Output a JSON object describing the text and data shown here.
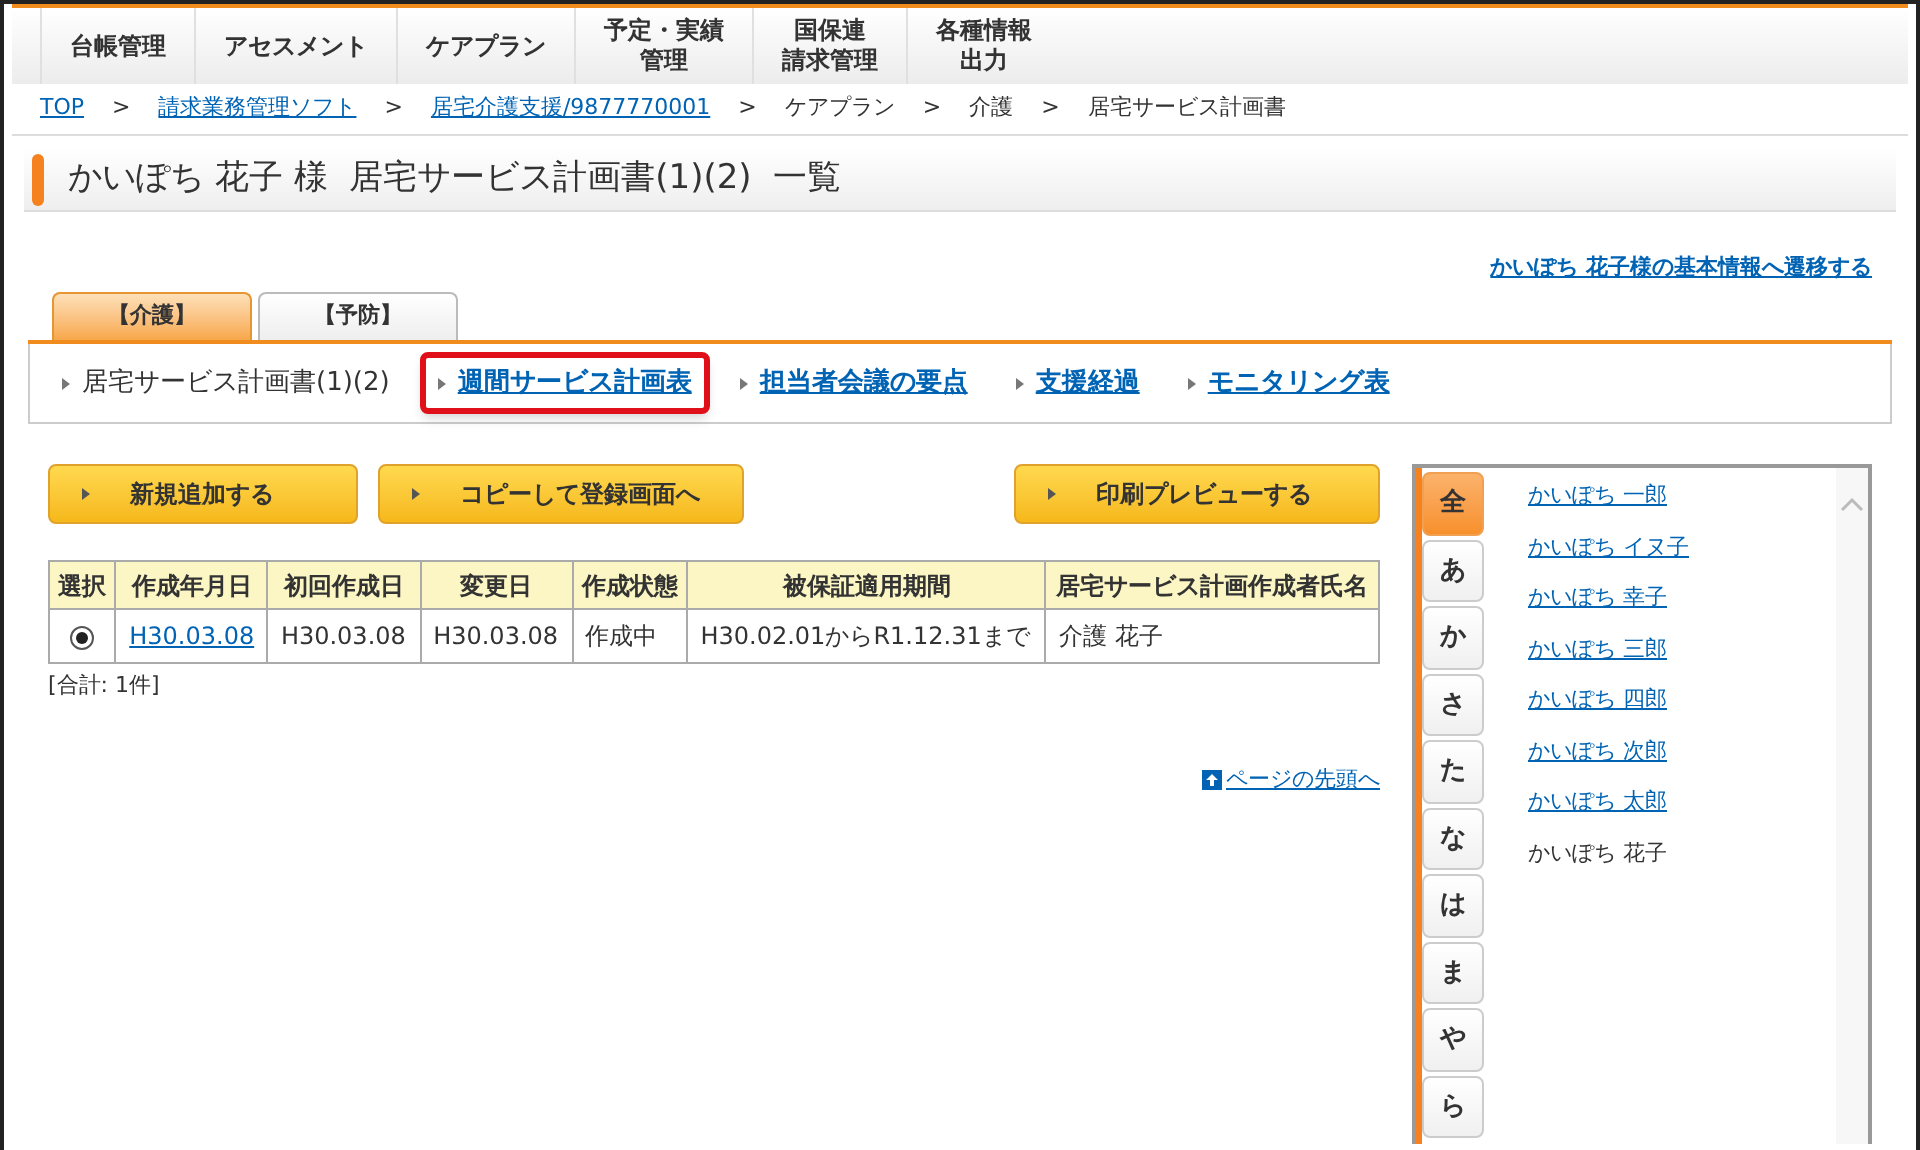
{
  "menu": [
    {
      "lines": [
        "台帳管理"
      ]
    },
    {
      "lines": [
        "アセスメント"
      ]
    },
    {
      "lines": [
        "ケアプラン"
      ]
    },
    {
      "lines": [
        "予定・実績",
        "管理"
      ]
    },
    {
      "lines": [
        "国保連",
        "請求管理"
      ]
    },
    {
      "lines": [
        "各種情報",
        "出力"
      ]
    }
  ],
  "breadcrumb": [
    {
      "label": "TOP",
      "link": true
    },
    {
      "label": "請求業務管理ソフト",
      "link": true
    },
    {
      "label": "居宅介護支援/9877770001",
      "link": true
    },
    {
      "label": "ケアプラン",
      "link": false
    },
    {
      "label": "介護",
      "link": false
    },
    {
      "label": "居宅サービス計画書",
      "link": false
    }
  ],
  "breadcrumb_separator": ">",
  "page_title": "かいぽち 花子 様  居宅サービス計画書(1)(2)  一覧",
  "basic_info_link": "かいぽち 花子様の基本情報へ遷移する",
  "tabs": [
    {
      "label": "【介護】",
      "selected": true
    },
    {
      "label": "【予防】",
      "selected": false
    }
  ],
  "subnav": [
    {
      "label": "居宅サービス計画書(1)(2)",
      "link": false,
      "highlighted": false
    },
    {
      "label": "週間サービス計画表",
      "link": true,
      "highlighted": true
    },
    {
      "label": "担当者会議の要点",
      "link": true,
      "highlighted": false
    },
    {
      "label": "支援経過",
      "link": true,
      "highlighted": false
    },
    {
      "label": "モニタリング表",
      "link": true,
      "highlighted": false
    }
  ],
  "buttons_left": [
    "新規追加する",
    "コピーして登録画面へ"
  ],
  "button_right": "印刷プレビューする",
  "table": {
    "columns": [
      "選択",
      "作成年月日",
      "初回作成日",
      "変更日",
      "作成状態",
      "被保証適用期間",
      "居宅サービス計画作成者氏名"
    ],
    "rows": [
      {
        "selected": true,
        "cells": [
          "",
          "H30.03.08",
          "H30.03.08",
          "H30.03.08",
          "作成中",
          "H30.02.01からR1.12.31まで",
          "介護 花子"
        ]
      }
    ]
  },
  "total": "[合計: 1件]",
  "page_top_link": "ページの先頭へ",
  "kana_tabs": [
    {
      "label": "全",
      "selected": true
    },
    {
      "label": "あ",
      "selected": false
    },
    {
      "label": "か",
      "selected": false
    },
    {
      "label": "さ",
      "selected": false
    },
    {
      "label": "た",
      "selected": false
    },
    {
      "label": "な",
      "selected": false
    },
    {
      "label": "は",
      "selected": false
    },
    {
      "label": "ま",
      "selected": false
    },
    {
      "label": "や",
      "selected": false
    },
    {
      "label": "ら",
      "selected": false
    }
  ],
  "clients": [
    {
      "name": "かいぽち 一郎",
      "selected": false
    },
    {
      "name": "かいぽち イヌ子",
      "selected": false
    },
    {
      "name": "かいぽち 幸子",
      "selected": false
    },
    {
      "name": "かいぽち 三郎",
      "selected": false
    },
    {
      "name": "かいぽち 四郎",
      "selected": false
    },
    {
      "name": "かいぽち 次郎",
      "selected": false
    },
    {
      "name": "かいぽち 太郎",
      "selected": false
    },
    {
      "name": "かいぽち 花子",
      "selected": true
    }
  ]
}
